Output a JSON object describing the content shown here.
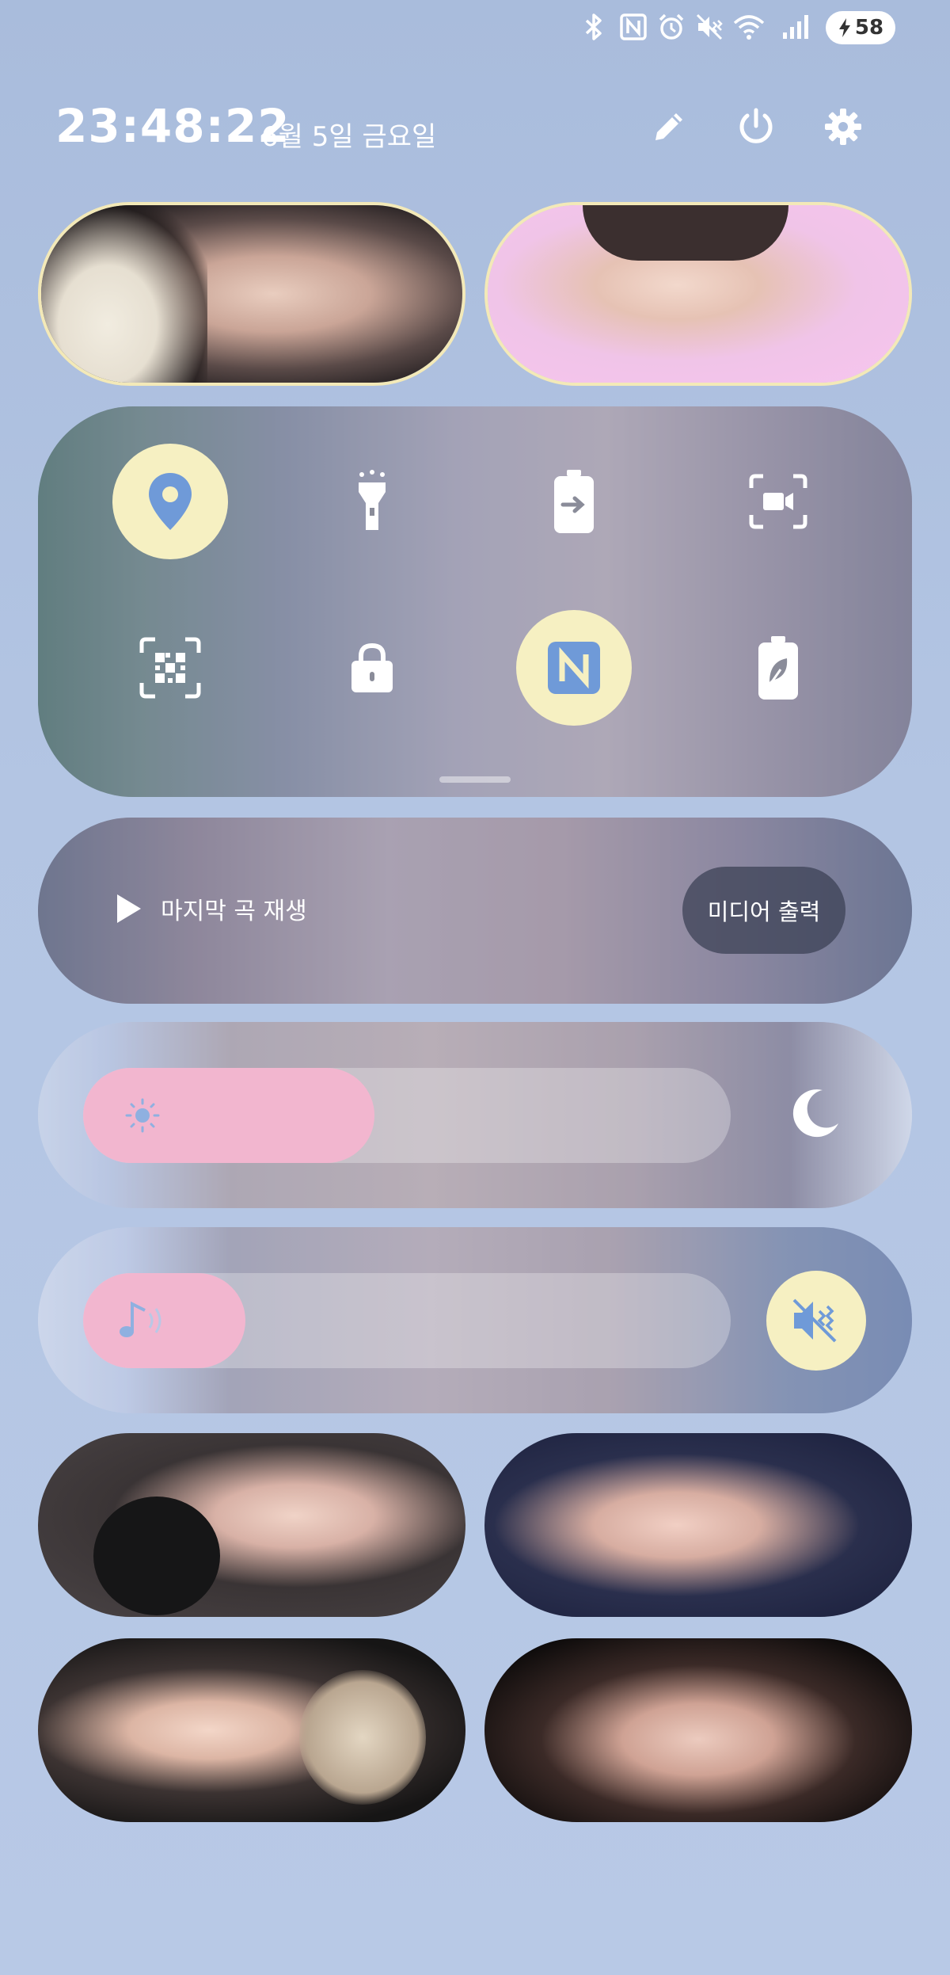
{
  "status_bar": {
    "icons": [
      "bluetooth-icon",
      "nfc-icon",
      "alarm-icon",
      "mute-icon",
      "wifi-icon",
      "signal-icon"
    ],
    "battery": "58"
  },
  "header": {
    "time": "23:48:22",
    "date": "6월 5일 금요일",
    "buttons": [
      "edit-icon",
      "power-icon",
      "settings-icon"
    ]
  },
  "toggles": [
    {
      "name": "location",
      "icon": "location-pin-icon",
      "on": true
    },
    {
      "name": "flashlight",
      "icon": "flashlight-icon",
      "on": false
    },
    {
      "name": "battery-share",
      "icon": "battery-share-icon",
      "on": false
    },
    {
      "name": "screen-record",
      "icon": "screen-record-icon",
      "on": false
    },
    {
      "name": "qr-scan",
      "icon": "qr-scan-icon",
      "on": false
    },
    {
      "name": "lock",
      "icon": "lock-icon",
      "on": false
    },
    {
      "name": "nfc",
      "icon": "nfc-icon",
      "on": true
    },
    {
      "name": "battery-saver",
      "icon": "battery-saver-icon",
      "on": false
    }
  ],
  "media": {
    "play_label": "마지막 곡 재생",
    "output_label": "미디어 출력"
  },
  "brightness": {
    "level": 0.45
  },
  "volume": {
    "level": 0.25,
    "mute_on": true
  },
  "colors": {
    "accent_on": "#f6f0c2",
    "icon_blue": "#6f9ad8",
    "fill_pink": "#f2b6cf"
  }
}
